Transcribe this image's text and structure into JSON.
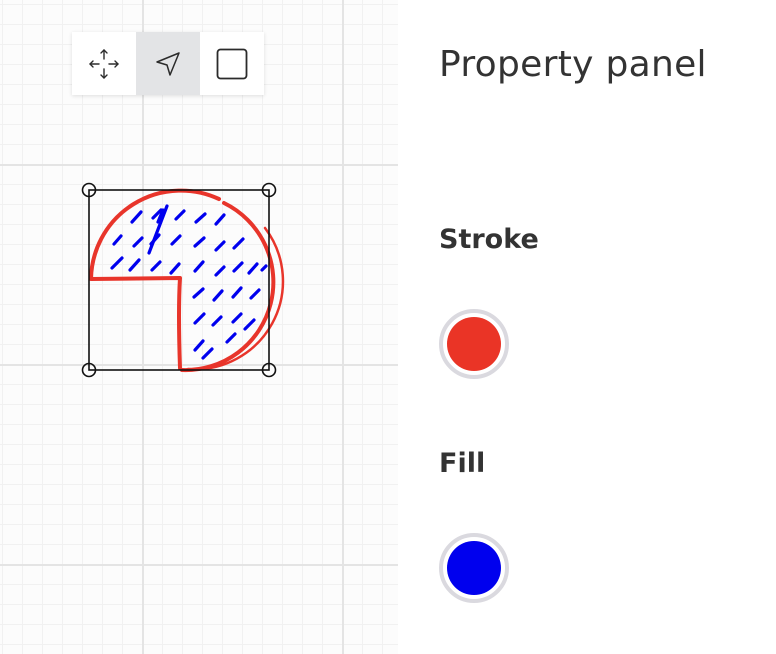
{
  "toolbar": {
    "tools": [
      {
        "id": "move",
        "icon": "move-arrows-icon",
        "active": false
      },
      {
        "id": "select",
        "icon": "cursor-arrow-icon",
        "active": true
      },
      {
        "id": "rectangle",
        "icon": "square-icon",
        "active": false
      }
    ]
  },
  "canvas": {
    "shape": {
      "kind": "pie",
      "stroke_color": "#e8352b",
      "fill_color": "#0000ee",
      "fill_style": "hachure"
    }
  },
  "panel": {
    "title": "Property panel",
    "stroke": {
      "label": "Stroke",
      "color": "#ea3426"
    },
    "fill": {
      "label": "Fill",
      "color": "#0000ee"
    }
  },
  "colors": {
    "canvas_bg": "#fcfcfc",
    "grid_major": "#e4e4e4",
    "grid_minor": "#f1f1f1",
    "active_tool_bg": "#e3e4e6",
    "swatch_ring": "#dad9df",
    "text": "#333333"
  }
}
